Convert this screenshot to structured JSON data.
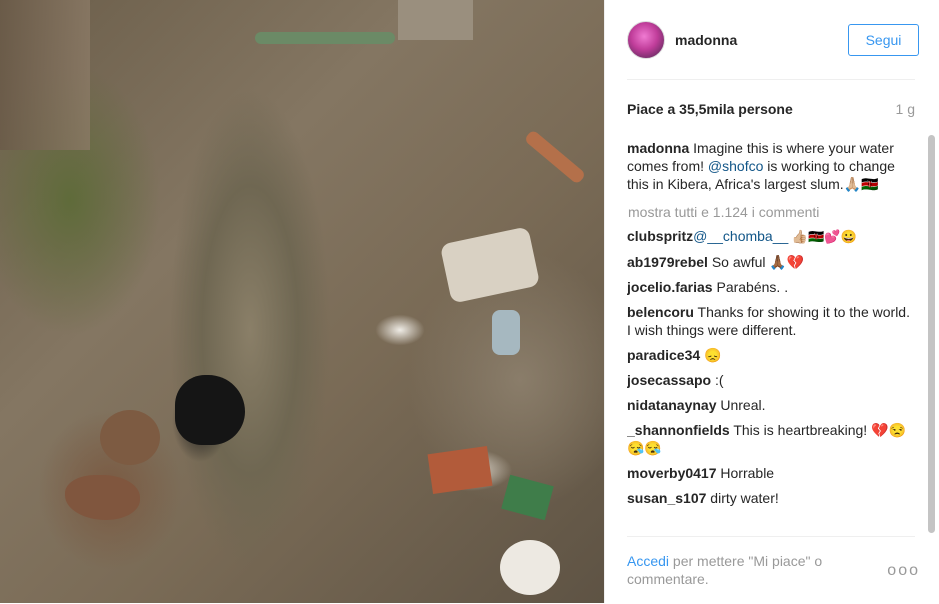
{
  "post": {
    "image_alt": "polluted stream full of garbage in Kibera"
  },
  "header": {
    "username": "madonna",
    "follow_label": "Segui"
  },
  "likes": {
    "text": "Piace a 35,5mila persone",
    "time": "1 g"
  },
  "caption": {
    "user": "madonna",
    "text_1": " Imagine this is where your water comes from! ",
    "mention": "@shofco",
    "text_2": " is working to change this in Kibera, Africa's largest slum.🙏🏼🇰🇪"
  },
  "show_all": "mostra tutti e 1.124 i commenti",
  "comments": [
    {
      "user": "clubspritz",
      "mention": "@__chomba__",
      "text": " 👍🏼🇰🇪💕😀"
    },
    {
      "user": "ab1979rebel",
      "mention": "",
      "text": " So awful 🙏🏾💔"
    },
    {
      "user": "jocelio.farias",
      "mention": "",
      "text": " Parabéns. ."
    },
    {
      "user": "belencoru",
      "mention": "",
      "text": " Thanks for showing it to the world. I wish things were different."
    },
    {
      "user": "paradice34",
      "mention": "",
      "text": " 😞"
    },
    {
      "user": "josecassapo",
      "mention": "",
      "text": " :("
    },
    {
      "user": "nidatanaynay",
      "mention": "",
      "text": " Unreal."
    },
    {
      "user": "_shannonfields",
      "mention": "",
      "text": " This is heartbreaking! 💔😒😪😪"
    },
    {
      "user": "moverby0417",
      "mention": "",
      "text": " Horrable"
    },
    {
      "user": "susan_s107",
      "mention": "",
      "text": " dirty water!"
    }
  ],
  "footer": {
    "login": "Accedi",
    "rest": " per mettere \"Mi piace\" o commentare.",
    "more": "ooo"
  },
  "colors": {
    "accent": "#3897f0",
    "link": "#125688",
    "muted": "#999999"
  }
}
